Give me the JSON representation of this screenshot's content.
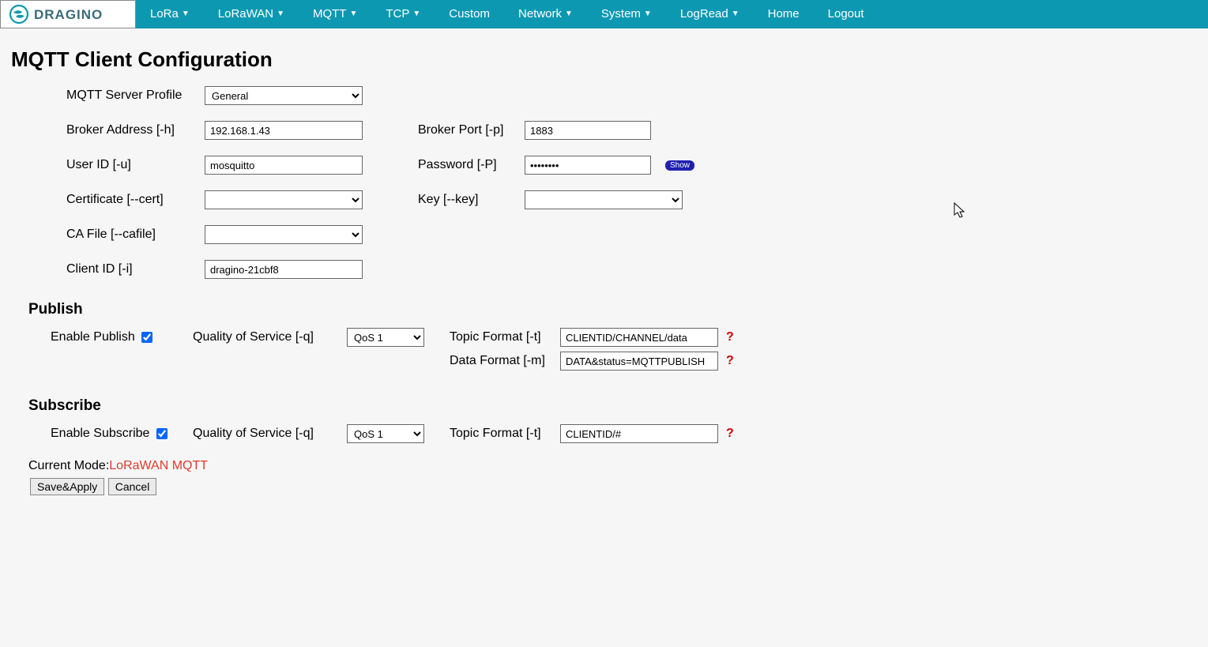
{
  "brand": "DRAGINO",
  "nav": {
    "lora": "LoRa",
    "lorawan": "LoRaWAN",
    "mqtt": "MQTT",
    "tcp": "TCP",
    "custom": "Custom",
    "network": "Network",
    "system": "System",
    "logread": "LogRead",
    "home": "Home",
    "logout": "Logout"
  },
  "page_title": "MQTT Client Configuration",
  "labels": {
    "profile": "MQTT Server Profile",
    "broker_addr": "Broker Address [-h]",
    "broker_port": "Broker Port [-p]",
    "user_id": "User ID [-u]",
    "password": "Password [-P]",
    "cert": "Certificate [--cert]",
    "key": "Key [--key]",
    "cafile": "CA File [--cafile]",
    "client_id": "Client ID [-i]",
    "publish": "Publish",
    "enable_publish": "Enable Publish",
    "subscribe": "Subscribe",
    "enable_subscribe": "Enable Subscribe",
    "qos": "Quality of Service [-q]",
    "topic_fmt": "Topic Format [-t]",
    "data_fmt": "Data Format [-m]",
    "show": "Show",
    "current_mode_pre": "Current Mode:",
    "save_apply": "Save&Apply",
    "cancel": "Cancel"
  },
  "values": {
    "profile_selected": "General",
    "broker_addr": "192.168.1.43",
    "broker_port": "1883",
    "user_id": "mosquitto",
    "password": "••••••••",
    "cert": "",
    "key": "",
    "cafile": "",
    "client_id": "dragino-21cbf8",
    "enable_publish": true,
    "enable_subscribe": true,
    "pub_qos": "QoS 1",
    "pub_topic": "CLIENTID/CHANNEL/data",
    "pub_data": "DATA&status=MQTTPUBLISH",
    "sub_qos": "QoS 1",
    "sub_topic": "CLIENTID/#",
    "current_mode": "LoRaWAN MQTT"
  },
  "help_icon": "?"
}
